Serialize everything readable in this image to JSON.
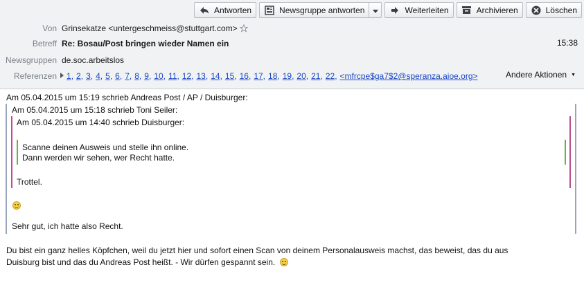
{
  "toolbar": {
    "reply": "Antworten",
    "reply_newsgroup": "Newsgruppe antworten",
    "forward": "Weiterleiten",
    "archive": "Archivieren",
    "delete": "Löschen"
  },
  "header": {
    "from_label": "Von",
    "from_value": "Grinsekatze <untergeschmeiss@stuttgart.com>",
    "subject_label": "Betreff",
    "subject_value": "Re: Bosau/Post bringen wieder Namen ein",
    "time": "15:38",
    "newsgroups_label": "Newsgruppen",
    "newsgroups_value": "de.soc.arbeitslos",
    "references_label": "Referenzen",
    "references": [
      "1",
      "2",
      "3",
      "4",
      "5",
      "6",
      "7",
      "8",
      "9",
      "10",
      "11",
      "12",
      "13",
      "14",
      "15",
      "16",
      "17",
      "18",
      "19",
      "20",
      "21",
      "22"
    ],
    "references_msgid": "<mfrcpe$ga7$2@speranza.aioe.org>",
    "other_actions": "Andere Aktionen"
  },
  "message": {
    "line1": "Am 05.04.2015 um 15:19 schrieb Andreas  Post / AP / Duisburger:",
    "q1_attrib": "Am 05.04.2015 um 15:18 schrieb Toni Seiler:",
    "q2_attrib": "Am 05.04.2015 um 14:40 schrieb Duisburger:",
    "q3_line1": "Scanne deinen Ausweis und stelle ihn online.",
    "q3_line2": "Dann werden wir sehen, wer Recht hatte.",
    "q2_trottel": "Trottel.",
    "q1_reply": "Sehr gut, ich hatte also Recht.",
    "reply_line1": "Du bist ein ganz helles Köpfchen, weil du jetzt hier und sofort einen Scan von deinem Personalausweis machst, das beweist, das du aus",
    "reply_line2": "Duisburg bist und das du Andreas  Post heißt. - Wir dürfen gespannt sein."
  },
  "colors": {
    "quote1": "#9aa4bd",
    "quote2": "#b94f8f",
    "quote3": "#6ab04c",
    "link": "#1b48c4"
  }
}
